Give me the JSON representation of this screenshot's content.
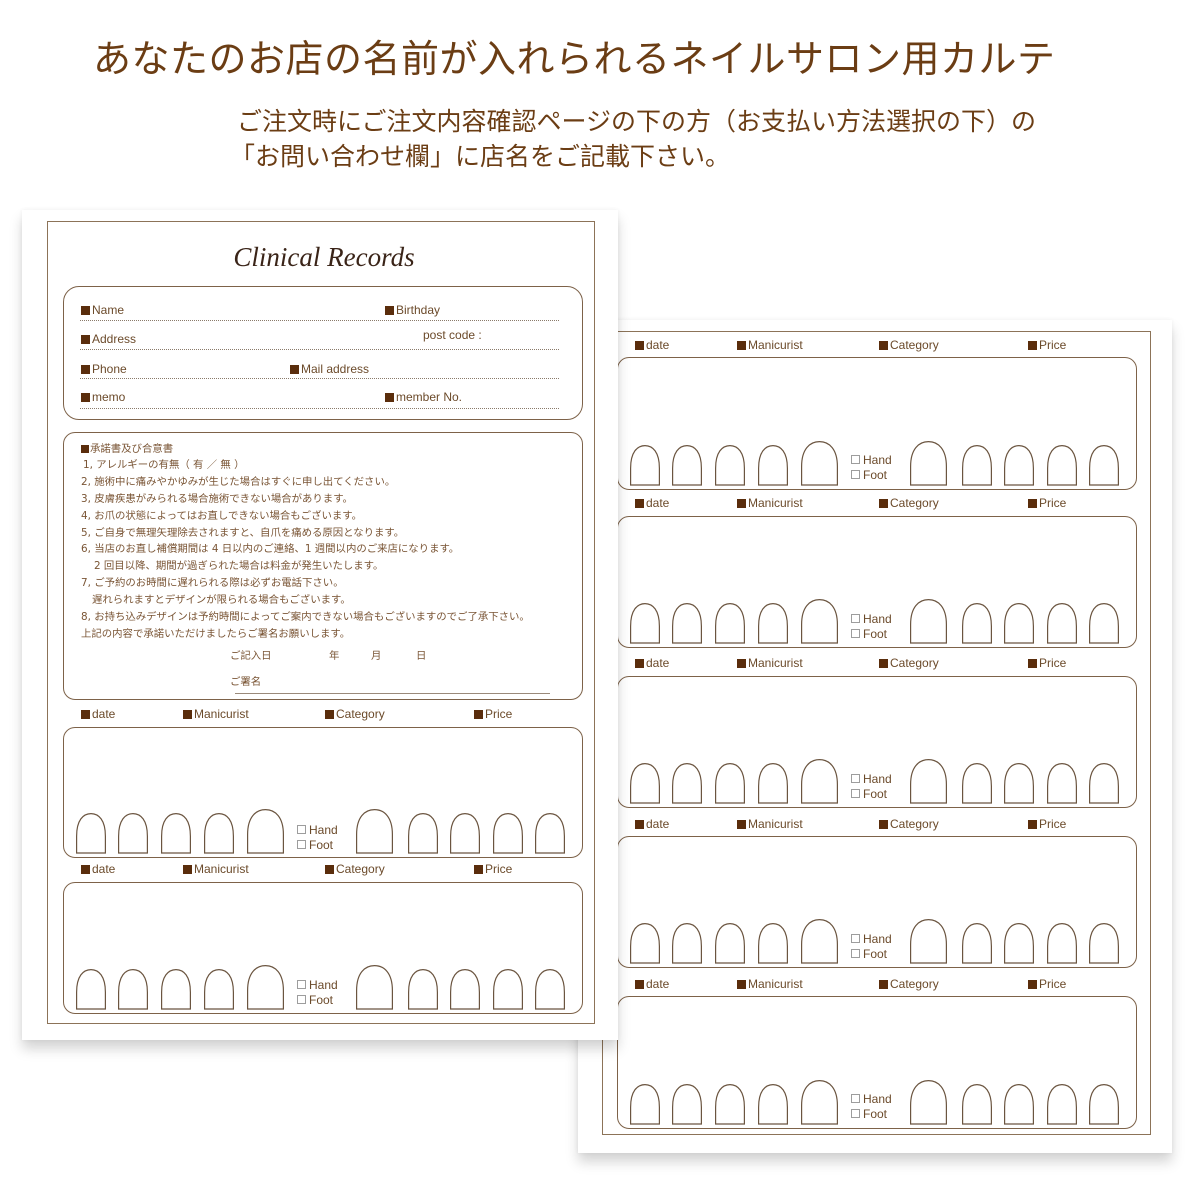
{
  "header": {
    "title": "あなたのお店の名前が入れられるネイルサロン用カルテ",
    "note_lines": [
      "ご注文時にご注文内容確認ページの下の方（お支払い方法選択の下）の",
      "「お問い合わせ欄」に店名をご記載下さい。"
    ]
  },
  "left_sheet": {
    "title": "Clinical Records",
    "info_fields": {
      "name": "Name",
      "birthday": "Birthday",
      "address": "Address",
      "post_code": "post code :",
      "phone": "Phone",
      "mail_address": "Mail address",
      "memo": "memo",
      "member_no": "member No."
    },
    "consent": {
      "heading": "承諾書及び合意書",
      "lines": [
        "1, アレルギーの有無（ 有 ／ 無 ）",
        "2, 施術中に痛みやかゆみが生じた場合はすぐに申し出てください。",
        "3, 皮膚疾患がみられる場合施術できない場合があります。",
        "4, お爪の状態によってはお直しできない場合もございます。",
        "5, ご自身で無理矢理除去されますと、自爪を痛める原因となります。",
        "6, 当店のお直し補償期間は 4 日以内のご連絡、1 週間以内のご来店になります。",
        "2 回目以降、期間が過ぎられた場合は料金が発生いたします。",
        "7, ご予約のお時間に遅れられる際は必ずお電話下さい。",
        "遅れられますとデザインが限られる場合もございます。",
        "8, お持ち込みデザインは予約時間によってご案内できない場合もございますのでご了承下さい。",
        "上記の内容で承諾いただけましたらご署名お願いします。"
      ],
      "entry_date_label": "ご記入日",
      "year": "年",
      "month": "月",
      "day": "日",
      "signature_label": "ご署名"
    },
    "records": [
      {
        "date": "date",
        "manicurist": "Manicurist",
        "category": "Category",
        "price": "Price",
        "hand": "Hand",
        "foot": "Foot"
      },
      {
        "date": "date",
        "manicurist": "Manicurist",
        "category": "Category",
        "price": "Price",
        "hand": "Hand",
        "foot": "Foot"
      }
    ]
  },
  "right_sheet": {
    "records": [
      {
        "date": "date",
        "manicurist": "Manicurist",
        "category": "Category",
        "price": "Price",
        "hand": "Hand",
        "foot": "Foot"
      },
      {
        "date": "date",
        "manicurist": "Manicurist",
        "category": "Category",
        "price": "Price",
        "hand": "Hand",
        "foot": "Foot"
      },
      {
        "date": "date",
        "manicurist": "Manicurist",
        "category": "Category",
        "price": "Price",
        "hand": "Hand",
        "foot": "Foot"
      },
      {
        "date": "date",
        "manicurist": "Manicurist",
        "category": "Category",
        "price": "Price",
        "hand": "Hand",
        "foot": "Foot"
      },
      {
        "date": "date",
        "manicurist": "Manicurist",
        "category": "Category",
        "price": "Price",
        "hand": "Hand",
        "foot": "Foot"
      }
    ]
  },
  "colors": {
    "text_brown": "#6b3d14",
    "bullet_brown": "#5a2d0c",
    "frame_tan": "#8c7358",
    "nail_outline": "#6b5540"
  }
}
